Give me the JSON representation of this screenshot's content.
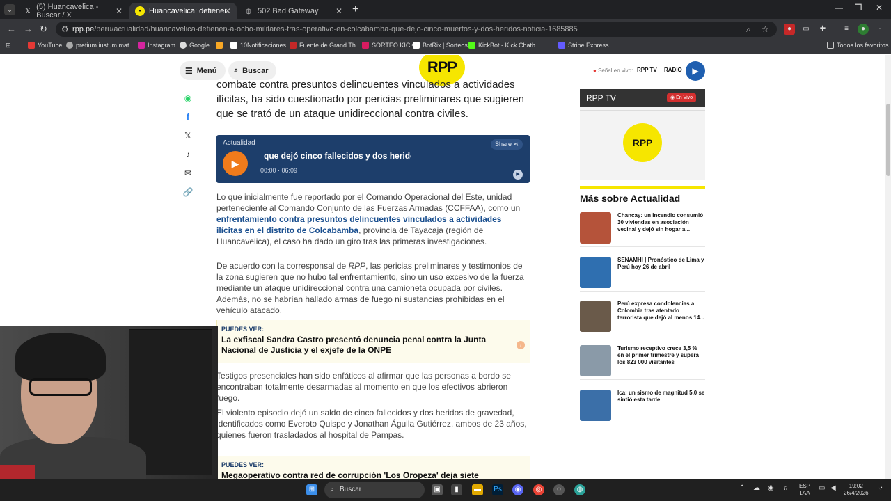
{
  "browser": {
    "tabs": [
      {
        "title": "(5) Huancavelica - Buscar / X",
        "icon": "x-logo-icon"
      },
      {
        "title": "Huancavelica: detienen a ocho",
        "icon": "rpp-favicon-icon"
      },
      {
        "title": "502 Bad Gateway",
        "icon": "globe-icon"
      }
    ],
    "url_prefix": "rpp.pe",
    "url_path": "/peru/actualidad/huancavelica-detienen-a-ocho-militares-tras-operativo-en-colcabamba-que-dejo-cinco-muertos-y-dos-heridos-noticia-1685885",
    "bookmarks": [
      "YouTube",
      "pretium iustum mat...",
      "Instagram",
      "Google",
      "10Notificaciones",
      "Fuente de Grand Th...",
      "SORTEO KICK",
      "BotRix | Sorteos",
      "KickBot - Kick Chatb...",
      "Stripe Express"
    ],
    "all_favorites": "Todos los favoritos"
  },
  "site": {
    "menu_label": "Menú",
    "search_label": "Buscar",
    "logo_text": "RPP",
    "live_signal": "Señal en vivo:",
    "rpp_tv_link": "RPP TV",
    "radio_link": "RADIO"
  },
  "article": {
    "lead": "combate contra presuntos delincuentes vinculados a actividades ilícitas, ha sido cuestionado por pericias preliminares que sugieren que se trató de un ataque unidireccional contra civiles.",
    "player": {
      "category": "Actualidad",
      "share": "Share",
      "title": "que dejó cinco fallecidos y dos heridos",
      "time": "00:00 · 06:09"
    },
    "p1_before": "Lo que inicialmente fue reportado por el Comando Operacional del Este, unidad perteneciente al Comando Conjunto de las Fuerzas Armadas (CCFFAA), como un ",
    "p1_link": "enfrentamiento contra presuntos delincuentes vinculados a actividades ilícitas en el distrito de Colcabamba",
    "p1_after": ", provincia de Tayacaja (región de Huancavelica), el caso ha dado un giro tras las primeras investigaciones.",
    "p2_before": "De acuerdo con la corresponsal de ",
    "p2_italic": "RPP",
    "p2_after": ", las pericias preliminares y testimonios de la zona sugieren que no hubo tal enfrentamiento, sino un uso excesivo de la fuerza mediante un ataque unidireccional contra una camioneta ocupada por civiles. Además, no se habrían hallado armas de fuego ni sustancias prohibidas en el vehículo atacado.",
    "puedes_label": "PUEDES VER:",
    "puedes1": "La exfiscal Sandra Castro presentó denuncia penal contra la Junta Nacional de Justicia y el exjefe de la ONPE",
    "p3": "Testigos presenciales han sido enfáticos al afirmar que las personas a bordo se encontraban totalmente desarmadas al momento en que los efectivos abrieron fuego.",
    "p4": "El violento episodio dejó un saldo de cinco fallecidos y dos heridos de gravedad, identificados como Everoto Quispe y Jonathan Águila Gutiérrez, ambos de 23 años, quienes fueron trasladados al hospital de Pampas.",
    "puedes2": "Megaoperativo contra red de corrupción 'Los Oropeza' deja siete"
  },
  "sidebar": {
    "tv_title": "RPP TV",
    "tv_live": "En Vivo",
    "mas_title": "Más sobre Actualidad",
    "news": [
      {
        "text": "Chancay: un incendio consumió 30 viviendas en asociación vecinal y dejó sin hogar a...",
        "color": "#b5533a"
      },
      {
        "text": "SENAMHI | Pronóstico de Lima y Perú hoy 26 de abril",
        "color": "#2f6fb0"
      },
      {
        "text": "Perú expresa condolencias a Colombia tras atentado terrorista que dejó al menos 14...",
        "color": "#6a5a4a"
      },
      {
        "text": "Turismo receptivo crece 3,5 % en el primer trimestre y supera los 823 000 visitantes",
        "color": "#8a9aa8"
      },
      {
        "text": "Ica: un sismo de magnitud 5.0 se sintió esta tarde",
        "color": "#3b6fa8"
      }
    ]
  },
  "taskbar": {
    "search": "Buscar",
    "lang_top": "ESP",
    "lang_bottom": "LAA",
    "time": "19:02",
    "date": "26/4/2026"
  }
}
